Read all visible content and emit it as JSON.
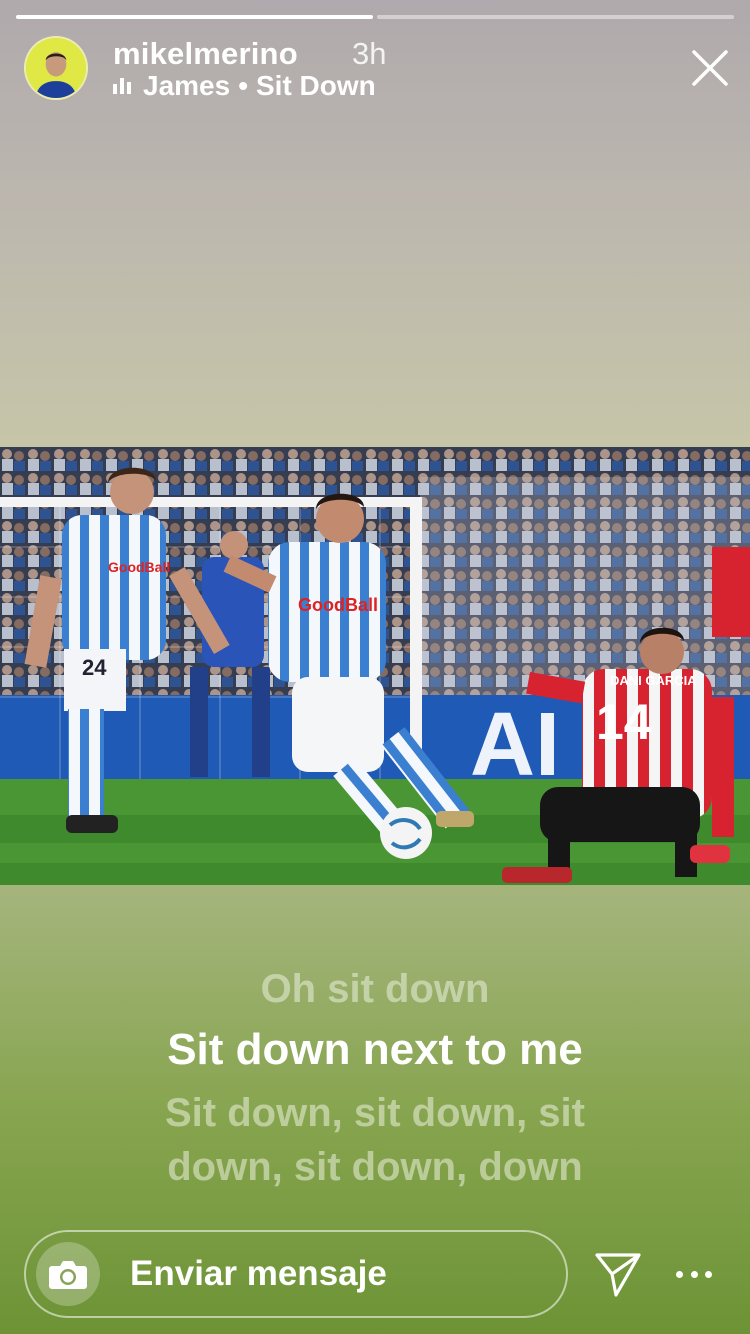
{
  "story": {
    "segments": [
      {
        "progress": 1.0
      },
      {
        "progress": 0.0
      },
      {
        "progress": 0.0
      },
      {
        "progress": 0.0
      }
    ]
  },
  "header": {
    "username": "mikelmerino",
    "time": "3h",
    "music_artist": "James",
    "music_separator": "•",
    "music_title": "Sit Down"
  },
  "lyrics": {
    "previous": "Oh sit down",
    "current": "Sit down next to me",
    "next": "Sit down, sit down, sit down, sit down, down"
  },
  "photo": {
    "jersey_sponsor": "GoodBall",
    "player_number_left": "24",
    "player_number_right": "14",
    "player_name_right": "DANI GARCIA"
  },
  "footer": {
    "message_placeholder": "Enviar mensaje"
  },
  "icons": {
    "close": "close-icon",
    "camera": "camera-icon",
    "send": "send-icon",
    "more": "more-icon",
    "music": "music-bars-icon"
  }
}
